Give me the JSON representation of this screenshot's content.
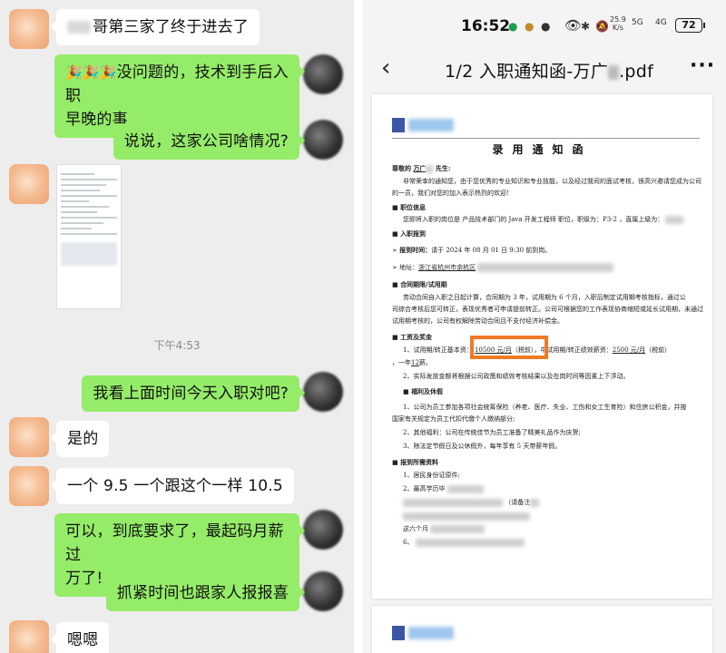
{
  "chat": {
    "messages": [
      {
        "side": "left",
        "text": "哥第三家了终于进去了"
      },
      {
        "side": "right",
        "emoji": "🎉🎉🎉",
        "text": "没问题的，技术到手后入职",
        "text2": "早晚的事"
      },
      {
        "side": "right",
        "text": "说说，这家公司啥情况?"
      },
      {
        "side": "right",
        "text": "我看上面时间今天入职对吧?"
      },
      {
        "side": "left",
        "text": "是的"
      },
      {
        "side": "left",
        "text": "一个 9.5 一个跟这个一样 10.5"
      },
      {
        "side": "right",
        "text": "可以，到底要求了，最起码月薪过",
        "text2": "万了!"
      },
      {
        "side": "right",
        "text": "抓紧时间也跟家人报报喜"
      },
      {
        "side": "left",
        "text": "嗯嗯"
      }
    ],
    "time_label": "下午4:53"
  },
  "status_bar": {
    "time": "16:52",
    "net_speed_value": "25.9",
    "net_speed_unit": "K/s",
    "signal_5g": "5G",
    "signal_4g": "4G",
    "battery": "72"
  },
  "viewer": {
    "title": "1/2 入职通知函-万广",
    "title_ext": ".pdf",
    "more": "···"
  },
  "document": {
    "heading": "录用通知函",
    "greeting": "尊敬的",
    "greeting_name": "万广",
    "greeting_suffix": "先生:",
    "intro1": "非常荣幸的通知您，由于您优秀的专业知识和专业技能，以及经过我司的面试考核，很高兴邀请您成为公司",
    "intro2": "的一员，我们对您的加入表示热烈的欢迎!",
    "sec_position": "职位信息",
    "position_line": "您即将入职的岗位是  产品技术部门的  Java 开发工程师  职位，职级为：P3-2  ，直属上级为：",
    "sec_onboard": "入职报到",
    "report_time_label": "报到时间：",
    "report_time": "请于  2024  年  08  月  01  日  9:30  前到岗。",
    "address_label": "地址：",
    "address": "浙江省杭州市余杭区",
    "sec_contract": "合同期限/试用期",
    "contract1": "劳动合同自入职之日起计算，合同期为  3  年，试用期为  6  个月，入职后制定试用期考核指标，通过公",
    "contract2": "司综合考核后您可转正，表现优秀者可申请提前转正。公司可根据您的工作表现协商缩短或延长试用期，未通过",
    "contract3": "试用期考核的，公司有权解除劳动合同且不支付经济补偿金。",
    "sec_salary": "工资及奖金",
    "salary1_a": "1、试用期/转正基本",
    "salary1_b": "资：",
    "salary_value": "10500 元/月",
    "salary_tax": "（税前）",
    "salary1_c": "，中试用期/转正绩效薪资：",
    "perf_value": "2500 元/月",
    "perf_tax": "（税前）",
    "salary_year": "，一年",
    "salary_months": "12",
    "salary_year_suffix": "薪。",
    "salary2": "2、实际发放金额将根据公司政策和绩效考核结果以及在岗时间等因素上下浮动。",
    "sec_welfare": "福利及休假",
    "welfare1": "1、公司为员工参加各项社会统筹保险（养老、医疗、失业、工伤和女工生育险）和住房公积金，并按",
    "welfare2": "国家有关规定为员工代扣代缴个人缴纳部分;",
    "welfare3": "2、其他福利：公司在传统佳节为员工准备了精美礼品作为庆贺;",
    "welfare4": "3、除法定节假日及公休假外，每年享有 5 天带薪年假。",
    "sec_docs": "报到所需资料",
    "doc1": "1、居民身份证原件;",
    "doc2": "2、最高学历毕",
    "doc3": "（请备注",
    "doc5": "这六个月",
    "doc6": "6、"
  }
}
